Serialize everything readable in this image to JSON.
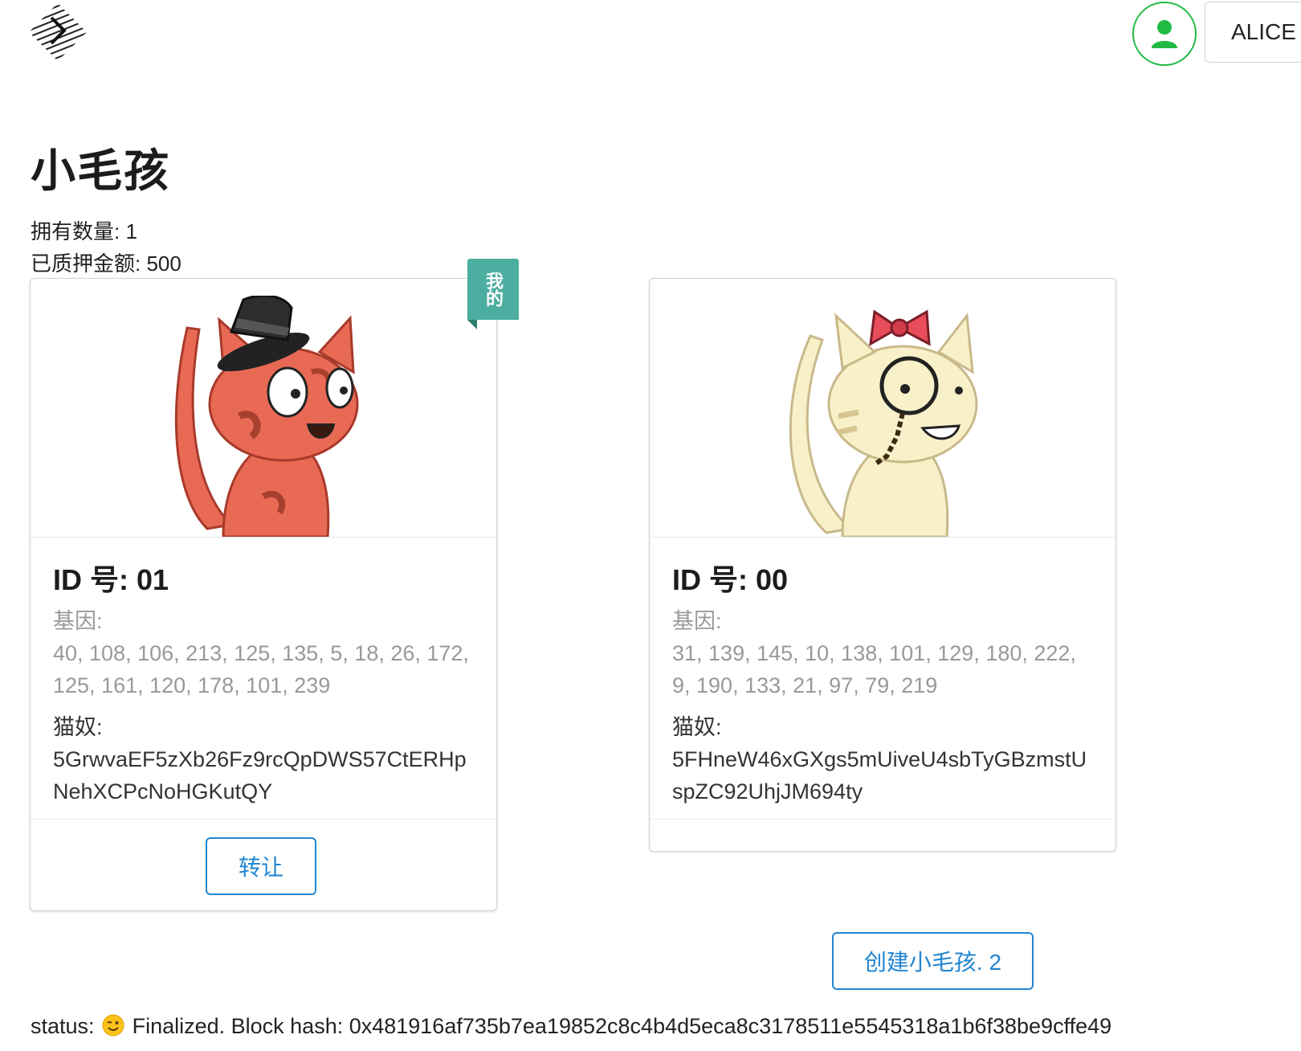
{
  "header": {
    "account_name": "ALICE",
    "account_icon": "user-icon"
  },
  "title": "小毛孩",
  "stats": {
    "owned": "拥有数量: 1",
    "staked": "已质押金额: 500"
  },
  "kitties": [
    {
      "id_label": "ID 号: 01",
      "dna_label": "基因:",
      "dna": "40, 108, 106, 213, 125, 135, 5, 18, 26, 172, 125, 161, 120, 178, 101, 239",
      "owner_label": "猫奴:",
      "owner": "5GrwvaEF5zXb26Fz9rcQpDWS57CtERHpNehXCPcNoHGKutQY",
      "badge": "我的",
      "transfer_label": "转让",
      "image": "red-cat-with-top-hat"
    },
    {
      "id_label": "ID 号: 00",
      "dna_label": "基因:",
      "dna": "31, 139, 145, 10, 138, 101, 129, 180, 222, 9, 190, 133, 21, 97, 79, 219",
      "owner_label": "猫奴:",
      "owner": "5FHneW46xGXgs5mUiveU4sbTyGBzmstUspZC92UhjJM694ty",
      "image": "cream-cat-with-bow-and-monocle"
    }
  ],
  "create_button_label": "创建小毛孩. 2",
  "status": {
    "prefix": "status:",
    "emoji": "wink-emoji",
    "text": "Finalized. Block hash: 0x481916af735b7ea19852c8c4b4d5eca8c3178511e5545318a1b6f38be9cffe49"
  },
  "colors": {
    "accent": "#2185d0",
    "user_ring": "#21ba45",
    "badge": "#4caea0",
    "cat_red": "#e86a55",
    "cat_cream": "#f8f0c8"
  }
}
